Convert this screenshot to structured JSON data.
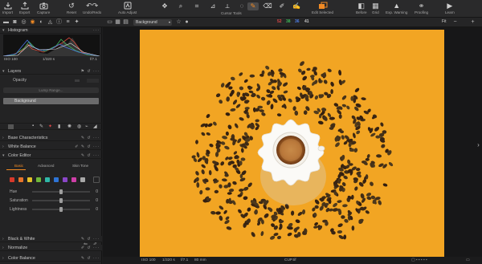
{
  "toolbar": {
    "items": [
      {
        "label": "Import",
        "icon": "import-icon"
      },
      {
        "label": "Export",
        "icon": "export-icon"
      },
      {
        "label": "Capture",
        "icon": "capture-icon"
      },
      {
        "label": "Reset",
        "icon": "reset-icon"
      },
      {
        "label": "Undo/Redo",
        "icon": "undo-redo-icon"
      },
      {
        "label": "Auto Adjust",
        "icon": "auto-adjust-icon"
      }
    ],
    "cursor_tools_label": "Cursor Tools",
    "edit_selected_label": "Edit Selected",
    "right_items": [
      {
        "label": "Before",
        "icon": "before-icon"
      },
      {
        "label": "Grid",
        "icon": "grid-icon"
      },
      {
        "label": "Exp. Warning",
        "icon": "exposure-warning-icon"
      },
      {
        "label": "Proofing",
        "icon": "proofing-icon"
      },
      {
        "label": "Learn",
        "icon": "learn-icon"
      }
    ]
  },
  "subbar": {
    "variant_name": "Background",
    "rgb_readout": {
      "r": "52",
      "g": "38",
      "b": "36",
      "l": "41"
    },
    "fit_label": "Fit",
    "accent_color": "#f08a24"
  },
  "left_panel": {
    "histogram": {
      "title": "Histogram",
      "iso": "ISO 100",
      "shutter": "1/320 s",
      "aperture": "f/7.1"
    },
    "layers": {
      "title": "Layers",
      "opacity_label": "Opacity",
      "lump_range_label": "Lump Range...",
      "background_layer": "Background"
    },
    "sections": {
      "base_characteristics": "Base Characteristics",
      "white_balance": "White Balance",
      "color_editor": "Color Editor",
      "color_balance": "Color Balance",
      "black_white": "Black & White",
      "normalize": "Normalize"
    },
    "color_editor": {
      "tabs": [
        "Basic",
        "Advanced",
        "Skin Tone"
      ],
      "active_tab": "Basic",
      "swatches": [
        "#d8392b",
        "#e8742a",
        "#e6c12a",
        "#6fb83a",
        "#2fb8a8",
        "#2e74d6",
        "#8a46c8",
        "#cf3fa8",
        "#a8a8a8"
      ],
      "sliders": [
        {
          "label": "Hue",
          "value": "0",
          "level": 0.5
        },
        {
          "label": "Saturation",
          "value": "0",
          "level": 0.5
        },
        {
          "label": "Lightness",
          "value": "0",
          "level": 0.5
        }
      ]
    }
  },
  "statusbar": {
    "iso": "ISO 100",
    "shutter": "1/320 s",
    "aperture": "f/7.1",
    "focal": "80 mm",
    "filename": "CUP.tif"
  }
}
